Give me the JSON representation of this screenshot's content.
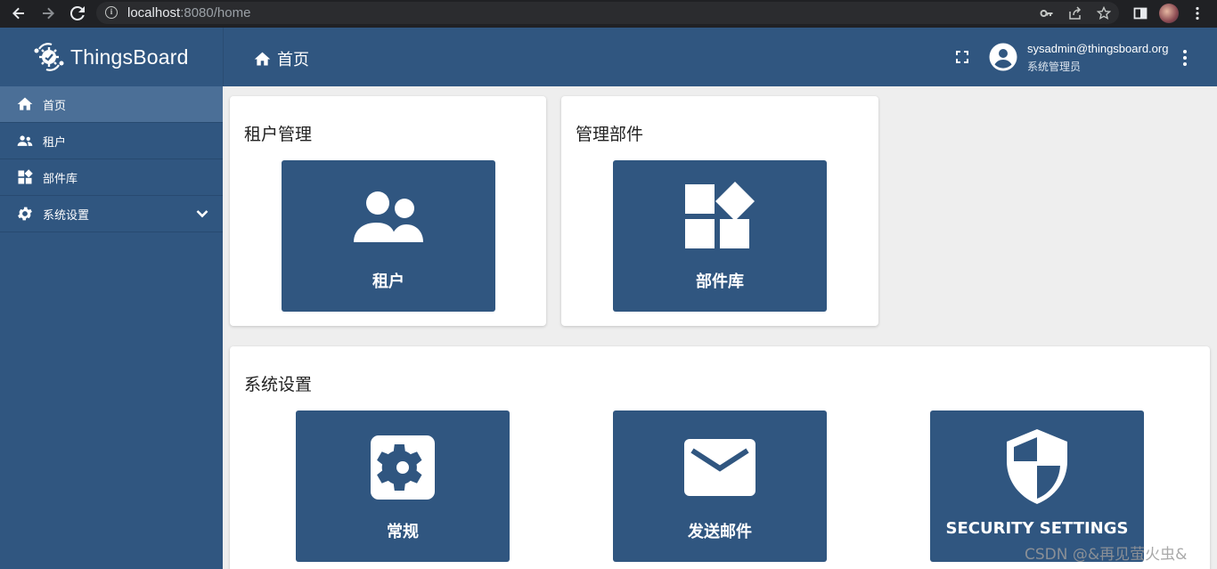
{
  "browser": {
    "url_host": "localhost",
    "url_rest": ":8080/home"
  },
  "header": {
    "brand": "ThingsBoard",
    "breadcrumb": "首页",
    "user_email": "sysadmin@thingsboard.org",
    "user_role": "系统管理员"
  },
  "sidebar": {
    "items": [
      {
        "label": "首页",
        "icon": "home-icon",
        "active": true
      },
      {
        "label": "租户",
        "icon": "people-icon"
      },
      {
        "label": "部件库",
        "icon": "widgets-icon"
      },
      {
        "label": "系统设置",
        "icon": "gear-icon",
        "expandable": true
      }
    ]
  },
  "main": {
    "tenant_card": {
      "title": "租户管理",
      "tile_label": "租户"
    },
    "widgets_card": {
      "title": "管理部件",
      "tile_label": "部件库"
    },
    "settings_card": {
      "title": "系统设置",
      "tiles": [
        {
          "label": "常规",
          "icon": "gear-icon"
        },
        {
          "label": "发送邮件",
          "icon": "mail-icon"
        },
        {
          "label": "SECURITY SETTINGS",
          "icon": "shield-icon"
        }
      ]
    }
  },
  "watermark": "CSDN @&再见萤火虫&",
  "colors": {
    "primary": "#305680",
    "sidebar_active": "#4b6f97",
    "background": "#eeeeee"
  }
}
